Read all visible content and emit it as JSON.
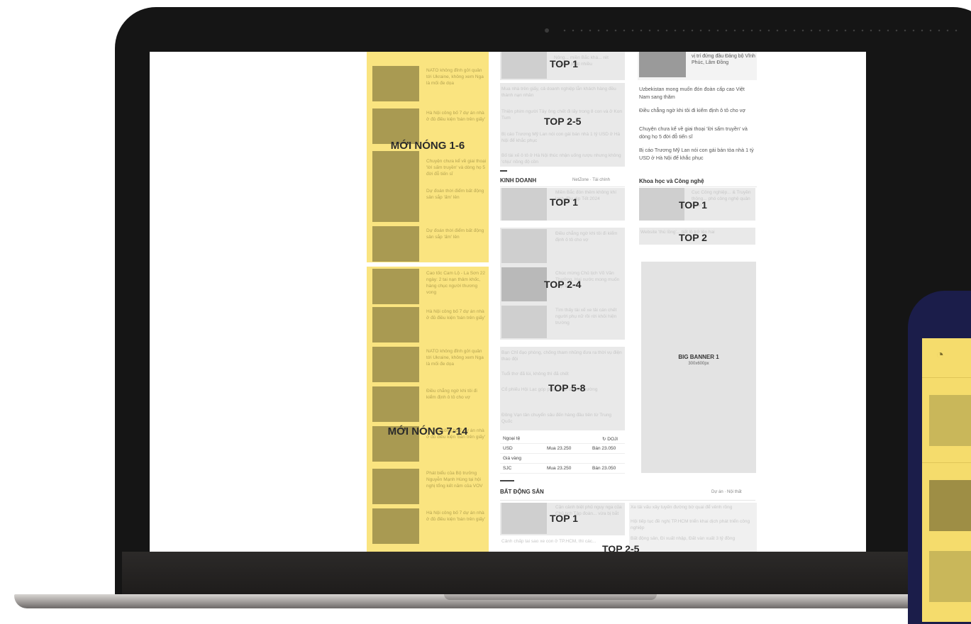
{
  "hot_news": {
    "label_1_6": "MỚI NÓNG 1-6",
    "label_7_14": "MỚI NÓNG 7-14",
    "items": [
      {
        "text": "NATO không đỉnh gởi quân tới Ukraine, không xem Nga là mối đe dọa"
      },
      {
        "text": "Hà Nội công bố 7 dự án nhà ở đủ điều kiện 'bán trên giấy'"
      },
      {
        "text": "Chuyện chưa kể về giai thoại 'lời sấm truyền' và dòng họ 5 đời đỗ tiến sĩ"
      },
      {
        "text": "Dự đoán thời điểm bất động sản sắp 'ấm' lên"
      },
      {
        "text": "Dự đoán thời điểm bất động sản sắp 'ấm' lên"
      },
      {
        "text": "Cao tốc Cam Lộ - La Sơn 22 ngày: 2 tai nạn thảm khốc, hàng chục người thương vong"
      },
      {
        "text": "Hà Nội công bố 7 dự án nhà ở đủ điều kiện 'bán trên giấy'"
      },
      {
        "text": "NATO không đỉnh gởi quân tới Ukraine, không xem Nga là mối đe dọa"
      },
      {
        "text": "Điều chẳng ngờ khi tôi đi kiểm định ô tô cho vợ"
      },
      {
        "text": "Hà Nội công bố 7 dự án nhà ở đủ điều kiện 'bán trên giấy'"
      },
      {
        "text": "Phát biểu của Bộ trưởng Nguyễn Mạnh Hùng tại hội nghị tổng kết năm của VOV"
      },
      {
        "text": "Hà Nội công bố 7 dự án nhà ở đủ điều kiện 'bán trên giấy'"
      }
    ]
  },
  "middle": {
    "top1_label": "TOP 1",
    "top1_text": "Nông... miền Bắc khá... rét mạnh... phát nhiều",
    "top25_label": "TOP 2-5",
    "top25_items": [
      "Mua nhà trên giấy, cả doanh nghiệp lẫn khách hàng đều thành nạn nhân",
      "Thiện phim người Tây ông chết đi lấy trong 8 con và ở Kon Tum",
      "Bị cáo Trương Mỹ Lan nói con gái bán nhà 1 tỷ USD ở Hà Nội để khắc phục",
      "Bố tài xế ô tô ở Hà Nội thúc nhận uống rượu nhưng không 'chịu' nồng độ cồn"
    ],
    "business": {
      "title": "KINH DOANH",
      "links": "NetZone · Tài chính",
      "top1_label": "TOP 1",
      "top1_text": "Miền Bắc đón thêm không khí lạnh đầu dịp Tết 2024",
      "top24_label": "TOP 2-4",
      "top24_items": [
        "Điều chẳng ngờ khi tôi đi kiểm định ô tô cho vợ",
        "Chúc mừng Chủ tịch Võ Văn Thưởng, Hai nước mong muốn hợp tác chặt",
        "Tìm thấy tài xế xe tải cán chết người phụ nữ rồi rời khỏi hiện trường"
      ],
      "top58_label": "TOP 5-8",
      "top58_items": [
        "Bạn Chỉ đạo phòng, chống tham nhũng đưa ra thời vụ điện thao đội",
        "Tuổi thơ đã lùi, không thì đã chết",
        "Cổ phiếu Hội Lạc góp phần thúc đẩy thị trường",
        "Đông Vạn tân chuyển sâu đến hàng đầu tiên từ Trung Quốc"
      ]
    },
    "fx": {
      "currency_label": "Ngoại tệ",
      "source": "DOJI",
      "rows": [
        {
          "name": "USD",
          "buy": "Mua 23.250",
          "sell": "Bán 23.050"
        },
        {
          "name": "SJC",
          "buy": "Mua 23.250",
          "sell": "Bán 23.050"
        }
      ],
      "gold_label": "Giá vàng"
    },
    "real_estate": {
      "title": "BẤT ĐỘNG SẢN",
      "links": "Dự án · Nội thất",
      "top1_label": "TOP 1",
      "top1_text": "Cận cảnh biệt phủ nguy nga của Chủ tịch Tập đoàn... vừa bị bắt",
      "top25_label": "TOP 2-5",
      "extra_text": "Cảnh chấp tai sao xe con ở TP.HCM, thì các..."
    }
  },
  "right": {
    "top_text": "vị trí đứng đầu Đảng bộ Vĩnh Phúc, Lâm Đồng",
    "links": [
      "Uzbekistan mong muốn đón đoàn cấp cao Việt Nam sang thăm",
      "Điều chẳng ngờ khi tôi đi kiểm định ô tô cho vợ",
      "Chuyện chưa kể về giai thoại 'lời sấm truyền' và dòng họ 5 đời đỗ tiến sĩ",
      "Bị cáo Trương Mỹ Lan nói con gái bán tòa nhà 1 tỷ USD ở Hà Nội để khắc phục"
    ],
    "science_title": "Khoa học và Công nghệ",
    "science_top1_label": "TOP 1",
    "science_top1_text": "Cục Công nghiệp... & Truyền thông... phó công nghệ quân đoàn",
    "science_top2_label": "TOP 2",
    "science_top2_text": "Website 'thú lồng'... tiết lộ trở lên hai",
    "banner_title": "BIG BANNER 1",
    "banner_size": "300x600px",
    "re_right_items": [
      "Xe tải vấu xây tuyến đường bờ quai để vênh rồng",
      "Hội tiếp tục đề nghị TP.HCM triển khai dịch phát triển công nghiệp",
      "Bất động sản, Đi xuất nhập, Đất vàn xuất 3 tỷ đồng"
    ]
  }
}
